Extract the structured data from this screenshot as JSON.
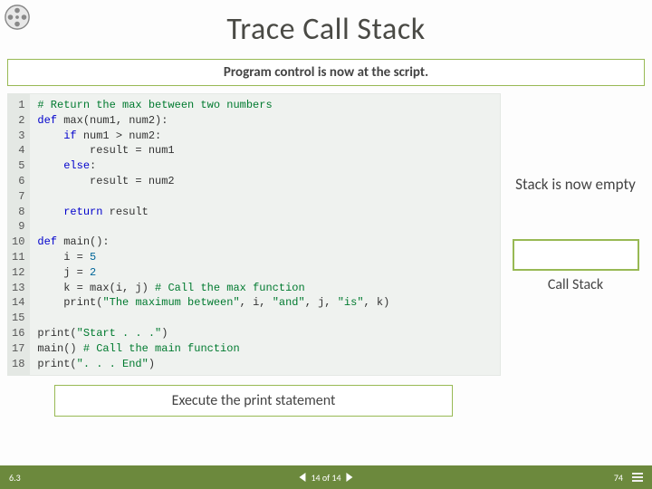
{
  "logo": {
    "name": "film-reel"
  },
  "title": "Trace Call Stack",
  "banner": "Program control is now at the script.",
  "code": {
    "line_count": 18,
    "l1_cmt": "# Return the max between two numbers",
    "l2_kw": "def",
    "l2_rest": " max(num1, num2):",
    "l3_kw": "if",
    "l3_rest": " num1 > num2:",
    "l4": "result = num1",
    "l5_kw": "else",
    "l5_rest": ":",
    "l6": "result = num2",
    "l8_kw": "return",
    "l8_rest": " result",
    "l10_kw": "def",
    "l10_rest": " main():",
    "l11a": "i = ",
    "l11n": "5",
    "l12a": "j = ",
    "l12n": "2",
    "l13a": "k = max(i, j) ",
    "l13c": "# Call the max function",
    "l14a": "print(",
    "l14s1": "\"The maximum between\"",
    "l14b": ", i, ",
    "l14s2": "\"and\"",
    "l14c": ", j, ",
    "l14s3": "\"is\"",
    "l14d": ", k)",
    "l16a": "print(",
    "l16s": "\"Start . . .\"",
    "l16b": ")",
    "l17a": "main() ",
    "l17c": "# Call the main function",
    "l18a": "print(",
    "l18s": "\". . . End\"",
    "l18b": ")"
  },
  "stack": {
    "note": "Stack is now empty",
    "label": "Call Stack"
  },
  "callout": "Execute the print statement",
  "footer": {
    "section": "6.3",
    "counter": "14 of 14",
    "page": "74"
  }
}
